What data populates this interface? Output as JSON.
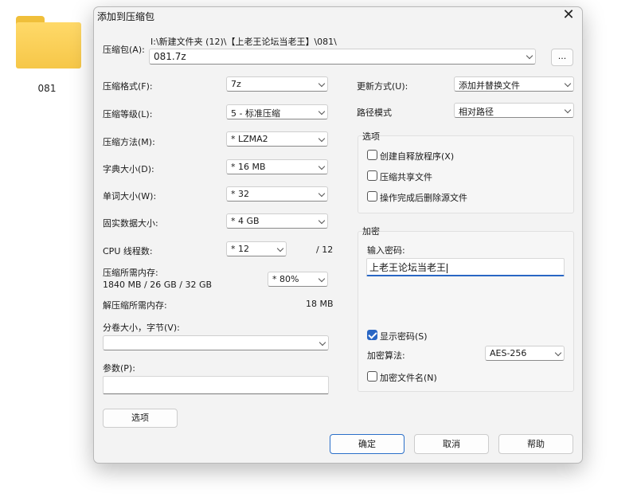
{
  "desktop": {
    "folder_label": "081"
  },
  "dialog": {
    "title": "添加到压缩包",
    "close_glyph": "✕",
    "archive_label": "压缩包(A):",
    "archive_path": "I:\\新建文件夹 (12)\\【上老王论坛当老王】\\081\\",
    "archive_name": "081.7z",
    "browse_label": "...",
    "format_label": "压缩格式(F):",
    "format_value": "7z",
    "level_label": "压缩等级(L):",
    "level_value": "5 - 标准压缩",
    "method_label": "压缩方法(M):",
    "method_value": "* LZMA2",
    "dict_label": "字典大小(D):",
    "dict_value": "* 16 MB",
    "word_label": "单词大小(W):",
    "word_value": "* 32",
    "solid_label": "固实数据大小:",
    "solid_value": "* 4 GB",
    "cpu_label": "CPU 线程数:",
    "cpu_value": "* 12",
    "cpu_total": "/ 12",
    "mem_comp_label": "压缩所需内存:",
    "mem_comp_value": "1840 MB / 26 GB / 32 GB",
    "mem_percent": "* 80%",
    "mem_decomp_label": "解压缩所需内存:",
    "mem_decomp_value": "18 MB",
    "volume_label": "分卷大小，字节(V):",
    "volume_value": "",
    "params_label": "参数(P):",
    "params_value": "",
    "options_button": "选项",
    "update_label": "更新方式(U):",
    "update_value": "添加并替换文件",
    "path_label": "路径模式",
    "path_value": "相对路径",
    "options_group": {
      "title": "选项",
      "sfx": "创建自释放程序(X)",
      "shared": "压缩共享文件",
      "delete": "操作完成后删除源文件"
    },
    "encrypt_group": {
      "title": "加密",
      "enter_pw_label": "输入密码:",
      "password": "上老王论坛当老王",
      "show_pw": "显示密码(S)",
      "method_label": "加密算法:",
      "method_value": "AES-256",
      "encrypt_names": "加密文件名(N)"
    },
    "ok": "确定",
    "cancel": "取消",
    "help": "帮助"
  }
}
